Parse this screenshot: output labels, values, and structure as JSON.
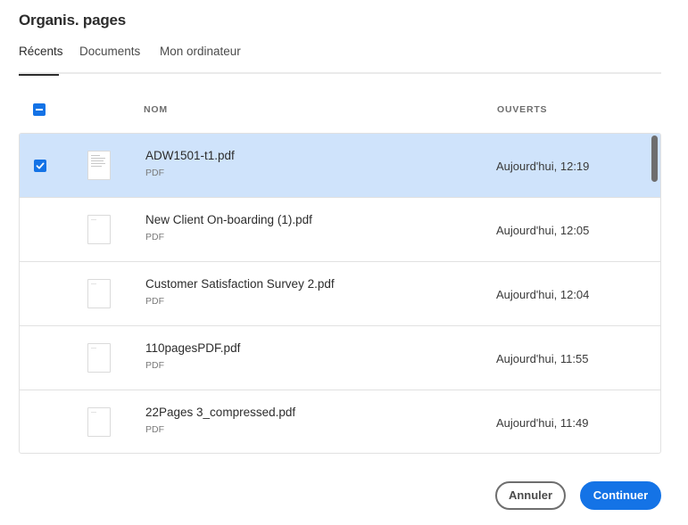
{
  "dialog": {
    "title": "Organis. pages"
  },
  "tabs": [
    {
      "label": "Récents",
      "active": true
    },
    {
      "label": "Documents",
      "active": false
    },
    {
      "label": "Mon ordinateur",
      "active": false
    }
  ],
  "table": {
    "columns": {
      "name": "NOM",
      "opened": "OUVERTS"
    },
    "select_all_state": "indeterminate",
    "rows": [
      {
        "name": "ADW1501-t1.pdf",
        "type": "PDF",
        "opened": "Aujourd'hui, 12:19",
        "selected": true
      },
      {
        "name": "New Client On-boarding (1).pdf",
        "type": "PDF",
        "opened": "Aujourd'hui, 12:05",
        "selected": false
      },
      {
        "name": "Customer Satisfaction Survey 2.pdf",
        "type": "PDF",
        "opened": "Aujourd'hui, 12:04",
        "selected": false
      },
      {
        "name": "110pagesPDF.pdf",
        "type": "PDF",
        "opened": "Aujourd'hui, 11:55",
        "selected": false
      },
      {
        "name": "22Pages 3_compressed.pdf",
        "type": "PDF",
        "opened": "Aujourd'hui, 11:49",
        "selected": false
      }
    ]
  },
  "buttons": {
    "cancel": "Annuler",
    "continue": "Continuer"
  },
  "colors": {
    "accent": "#1473e6",
    "selected_row": "#cfe3fb"
  }
}
